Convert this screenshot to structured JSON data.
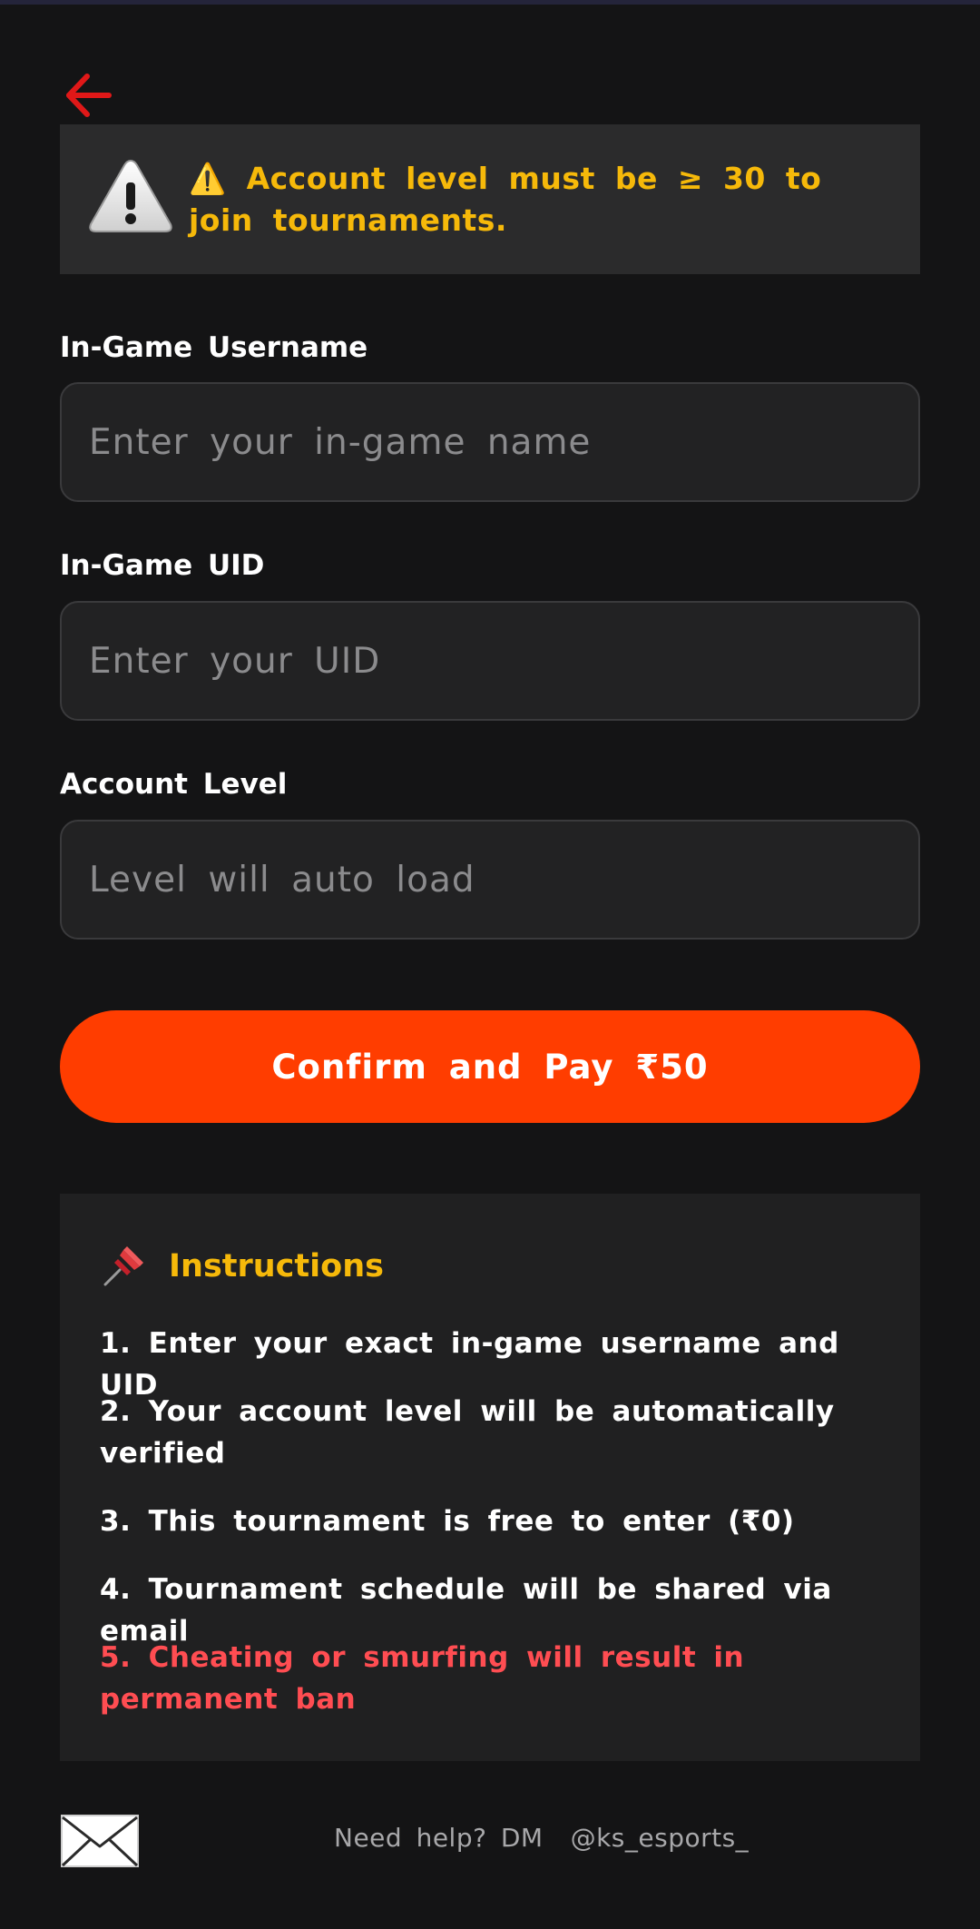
{
  "colors": {
    "background": "#141415",
    "warning_text": "#f6b90a",
    "accent": "#ff3d00",
    "danger": "#ff4d52",
    "back_arrow": "#e01818"
  },
  "nav": {
    "back_icon": "arrow-left-icon"
  },
  "warning": {
    "icon": "warning-triangle-icon",
    "text": "⚠️ Account level must be ≥ 30 to join tournaments."
  },
  "form": {
    "username": {
      "label": "In-Game Username",
      "placeholder": "Enter your in-game name",
      "value": ""
    },
    "uid": {
      "label": "In-Game UID",
      "placeholder": "Enter your UID",
      "value": ""
    },
    "level": {
      "label": "Account Level",
      "placeholder": "Level will auto load",
      "value": ""
    },
    "submit_label": "Confirm and Pay ₹50"
  },
  "instructions": {
    "icon": "pushpin-icon",
    "title": "Instructions",
    "items": [
      "1. Enter your exact in-game username and UID",
      "2. Your account level will be automatically verified",
      "3. This tournament is free to enter (₹0)",
      "4. Tournament schedule will be shared via email",
      "5. Cheating or smurfing will result in permanent ban"
    ]
  },
  "footer": {
    "icon": "envelope-icon",
    "help_text": "Need help? DM",
    "handle": "@ks_esports_"
  }
}
